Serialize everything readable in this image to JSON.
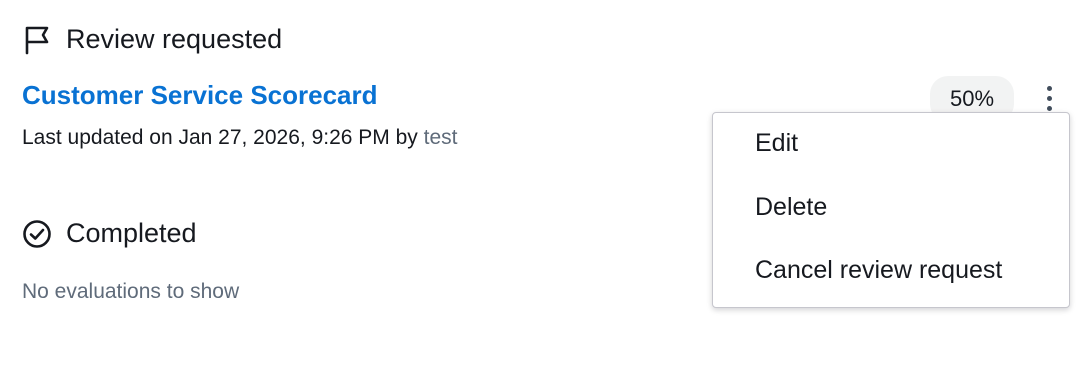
{
  "review_section": {
    "title": "Review requested",
    "icon": "flag-icon"
  },
  "scorecard": {
    "name": "Customer Service Scorecard",
    "updated_prefix": "Last updated on Jan 27, 2026, 9:26 PM by ",
    "updated_by": "test",
    "progress_label": "50%",
    "actions_icon": "more-vertical-icon"
  },
  "completed_section": {
    "title": "Completed",
    "icon": "check-circle-icon",
    "empty_text": "No evaluations to show"
  },
  "menu": {
    "items": [
      {
        "label": "Edit"
      },
      {
        "label": "Delete"
      },
      {
        "label": "Cancel review request"
      }
    ]
  },
  "colors": {
    "link": "#0972d3",
    "text": "#16191f",
    "muted": "#5f6b7a",
    "badge_bg": "#f2f3f3"
  }
}
